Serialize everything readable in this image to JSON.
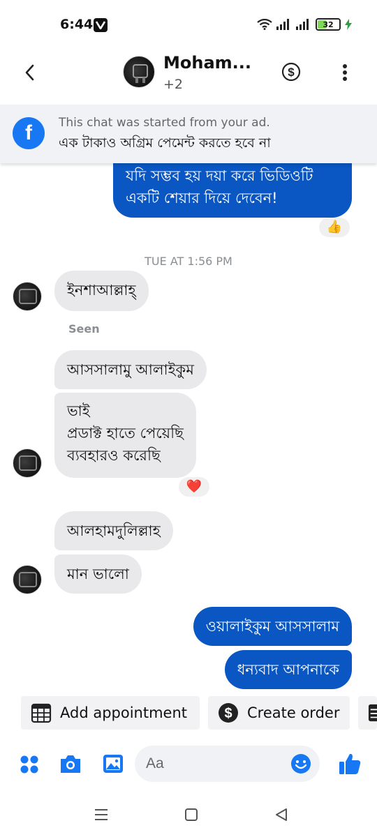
{
  "status_bar": {
    "time": "6:44",
    "battery": "32"
  },
  "header": {
    "name": "Moham...",
    "participants": "+2"
  },
  "ad_banner": {
    "line1": "This chat was started from your ad.",
    "line2": "এক টাকাও অগ্রিম পেমেন্ট করতে হবে না"
  },
  "messages": {
    "out_first": {
      "line1": "যদি সম্ভব হয় দয়া করে ভিডিওটি",
      "line2": "একটি শেয়ার দিয়ে দেবেন!",
      "reaction": "👍"
    },
    "timestamp": "TUE AT 1:56 PM",
    "in_1": "ইনশাআল্লাহ্",
    "seen": "Seen",
    "in_2": "আসসালামু আলাইকুম",
    "in_3": {
      "line1": "ভাই",
      "line2": "প্রডাক্ট হাতে পেয়েছি",
      "line3": "ব্যবহারও করেছি",
      "reaction": "❤️"
    },
    "in_4": "আলহামদুলিল্লাহ",
    "in_5": "মান ভালো",
    "out_2": "ওয়ালাইকুম আসসালাম",
    "out_3": "ধন্যবাদ আপনাকে"
  },
  "quick_actions": {
    "appointment": "Add appointment",
    "order": "Create order"
  },
  "composer": {
    "placeholder": "Aa"
  },
  "colors": {
    "accent": "#0a56c2",
    "facebook": "#1877f2",
    "icon_blue": "#1877f2",
    "incoming_bubble": "#e9e9eb"
  }
}
